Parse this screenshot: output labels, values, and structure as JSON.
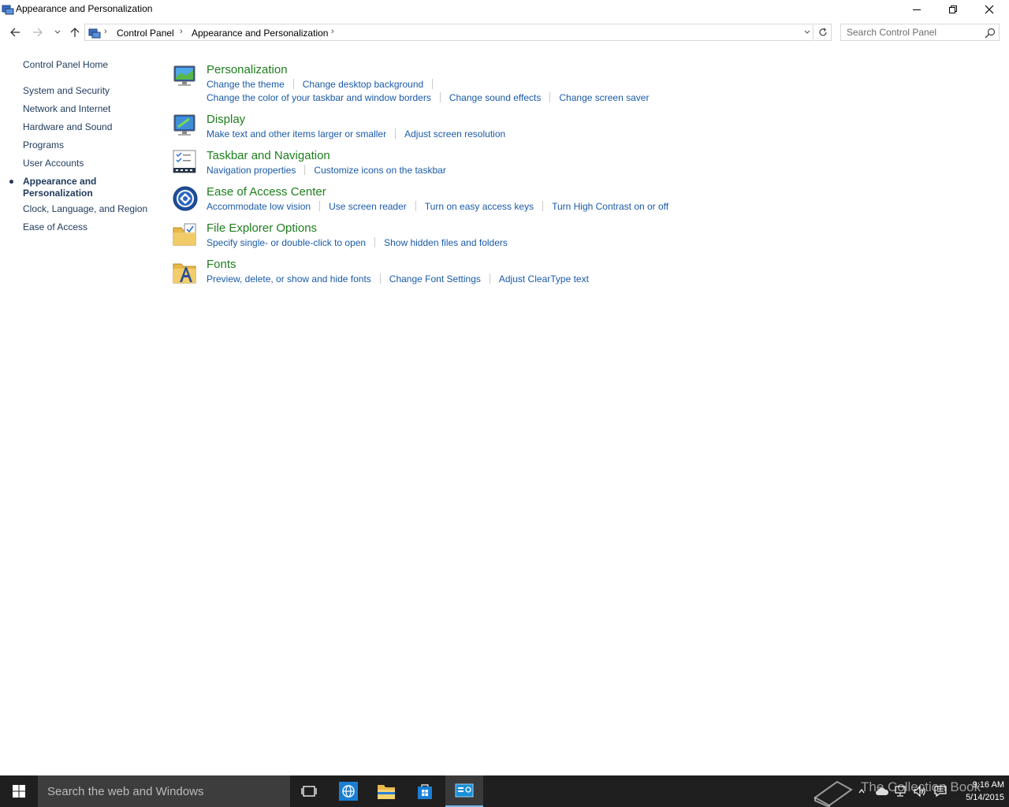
{
  "window": {
    "title": "Appearance and Personalization",
    "minimize_icon": "minimize-icon",
    "restore_icon": "restore-icon",
    "close_icon": "close-icon"
  },
  "address": {
    "crumbs": [
      "Control Panel",
      "Appearance and Personalization"
    ],
    "search_placeholder": "Search Control Panel"
  },
  "sidebar": {
    "home": "Control Panel Home",
    "items": [
      "System and Security",
      "Network and Internet",
      "Hardware and Sound",
      "Programs",
      "User Accounts",
      "Appearance and Personalization",
      "Clock, Language, and Region",
      "Ease of Access"
    ],
    "active_index": 5
  },
  "categories": [
    {
      "title": "Personalization",
      "icon": "personalization-icon",
      "links": [
        [
          "Change the theme",
          "Change desktop background"
        ],
        [
          "Change the color of your taskbar and window borders",
          "Change sound effects",
          "Change screen saver"
        ]
      ]
    },
    {
      "title": "Display",
      "icon": "display-icon",
      "links": [
        [
          "Make text and other items larger or smaller",
          "Adjust screen resolution"
        ]
      ]
    },
    {
      "title": "Taskbar and Navigation",
      "icon": "taskbar-icon",
      "links": [
        [
          "Navigation properties",
          "Customize icons on the taskbar"
        ]
      ]
    },
    {
      "title": "Ease of Access Center",
      "icon": "ease-of-access-icon",
      "links": [
        [
          "Accommodate low vision",
          "Use screen reader",
          "Turn on easy access keys",
          "Turn High Contrast on or off"
        ]
      ]
    },
    {
      "title": "File Explorer Options",
      "icon": "folder-options-icon",
      "links": [
        [
          "Specify single- or double-click to open",
          "Show hidden files and folders"
        ]
      ]
    },
    {
      "title": "Fonts",
      "icon": "fonts-folder-icon",
      "links": [
        [
          "Preview, delete, or show and hide fonts",
          "Change Font Settings",
          "Adjust ClearType text"
        ]
      ]
    }
  ],
  "taskbar": {
    "search_placeholder": "Search the web and Windows",
    "time": "9:16 AM",
    "date": "5/14/2015",
    "watermark": "The Collection Book"
  },
  "colors": {
    "category_title": "#1e7e1e",
    "link": "#1a5aa8",
    "sidebar_text": "#1e395b",
    "taskbar_bg": "#1f1f1f"
  }
}
